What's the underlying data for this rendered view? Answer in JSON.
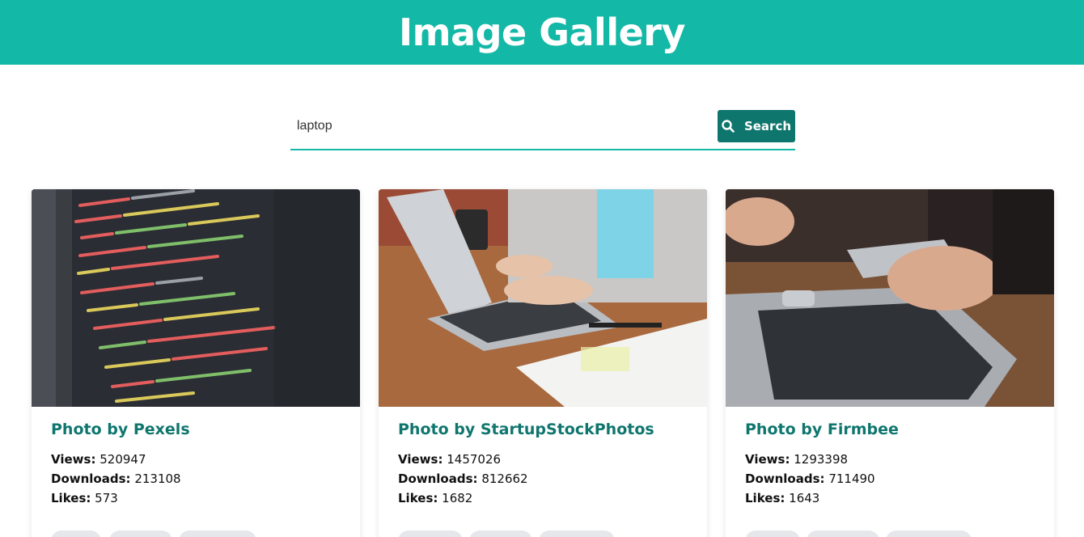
{
  "header": {
    "title": "Image Gallery"
  },
  "search": {
    "value": "laptop",
    "button_label": "Search"
  },
  "cards": [
    {
      "title": "Photo by Pexels",
      "views_label": "Views:",
      "views": "520947",
      "downloads_label": "Downloads:",
      "downloads": "213108",
      "likes_label": "Likes:",
      "likes": "573"
    },
    {
      "title": "Photo by StartupStockPhotos",
      "views_label": "Views:",
      "views": "1457026",
      "downloads_label": "Downloads:",
      "downloads": "812662",
      "likes_label": "Likes:",
      "likes": "1682"
    },
    {
      "title": "Photo by Firmbee",
      "views_label": "Views:",
      "views": "1293398",
      "downloads_label": "Downloads:",
      "downloads": "711490",
      "likes_label": "Likes:",
      "likes": "1643"
    }
  ],
  "colors": {
    "header": "#14b8a6",
    "button": "#0f766e",
    "title": "#0f766e",
    "tag": "#e5e7eb"
  },
  "icons": {
    "search_button": "search-icon"
  }
}
